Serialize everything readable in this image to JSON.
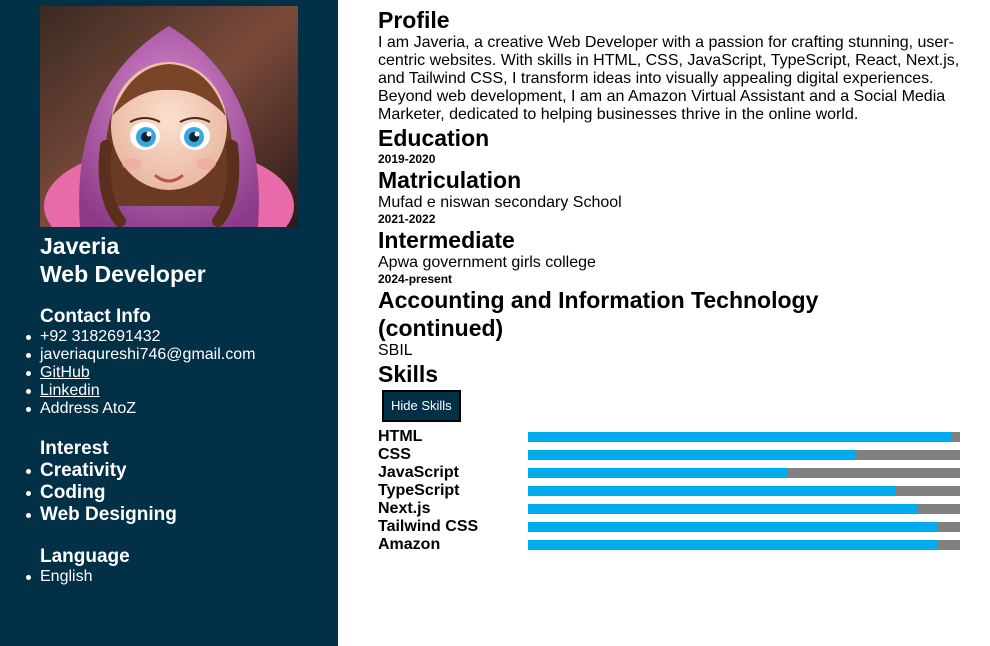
{
  "sidebar": {
    "name": "Javeria",
    "role": "Web Developer",
    "contact": {
      "title": "Contact Info",
      "phone": "+92 3182691432",
      "email": "javeriaqureshi746@gmail.com",
      "github": "GitHub",
      "linkedin": "Linkedin",
      "address": "Address AtoZ"
    },
    "interest": {
      "title": "Interest",
      "items": [
        "Creativity",
        "Coding",
        "Web Designing"
      ]
    },
    "language": {
      "title": "Language",
      "items": [
        "English"
      ]
    }
  },
  "main": {
    "profile_title": "Profile",
    "profile_text": "I am Javeria, a creative Web Developer with a passion for crafting stunning, user-centric websites. With skills in HTML, CSS, JavaScript, TypeScript, React, Next.js, and Tailwind CSS, I transform ideas into visually appealing digital experiences. Beyond web development, I am an Amazon Virtual Assistant and a Social Media Marketer, dedicated to helping businesses thrive in the online world.",
    "education_title": "Education",
    "education": [
      {
        "years": "2019-2020",
        "degree": "Matriculation",
        "school": "Mufad e niswan secondary School"
      },
      {
        "years": "2021-2022",
        "degree": "Intermediate",
        "school": "Apwa government girls college"
      },
      {
        "years": "2024-present",
        "degree": "Accounting and Information Technology (continued)",
        "school": "SBIL"
      }
    ],
    "skills_title": "Skills",
    "toggle_button": "Hide Skills",
    "skills": [
      {
        "name": "HTML",
        "level": 98
      },
      {
        "name": "CSS",
        "level": 76
      },
      {
        "name": "JavaScript",
        "level": 60
      },
      {
        "name": "TypeScript",
        "level": 85
      },
      {
        "name": "Next.js",
        "level": 90
      },
      {
        "name": "Tailwind CSS",
        "level": 95
      },
      {
        "name": "Amazon",
        "level": 95
      }
    ]
  },
  "colors": {
    "sidebar_bg": "#023047",
    "bar_fill": "#00acee",
    "bar_track": "#808080"
  }
}
